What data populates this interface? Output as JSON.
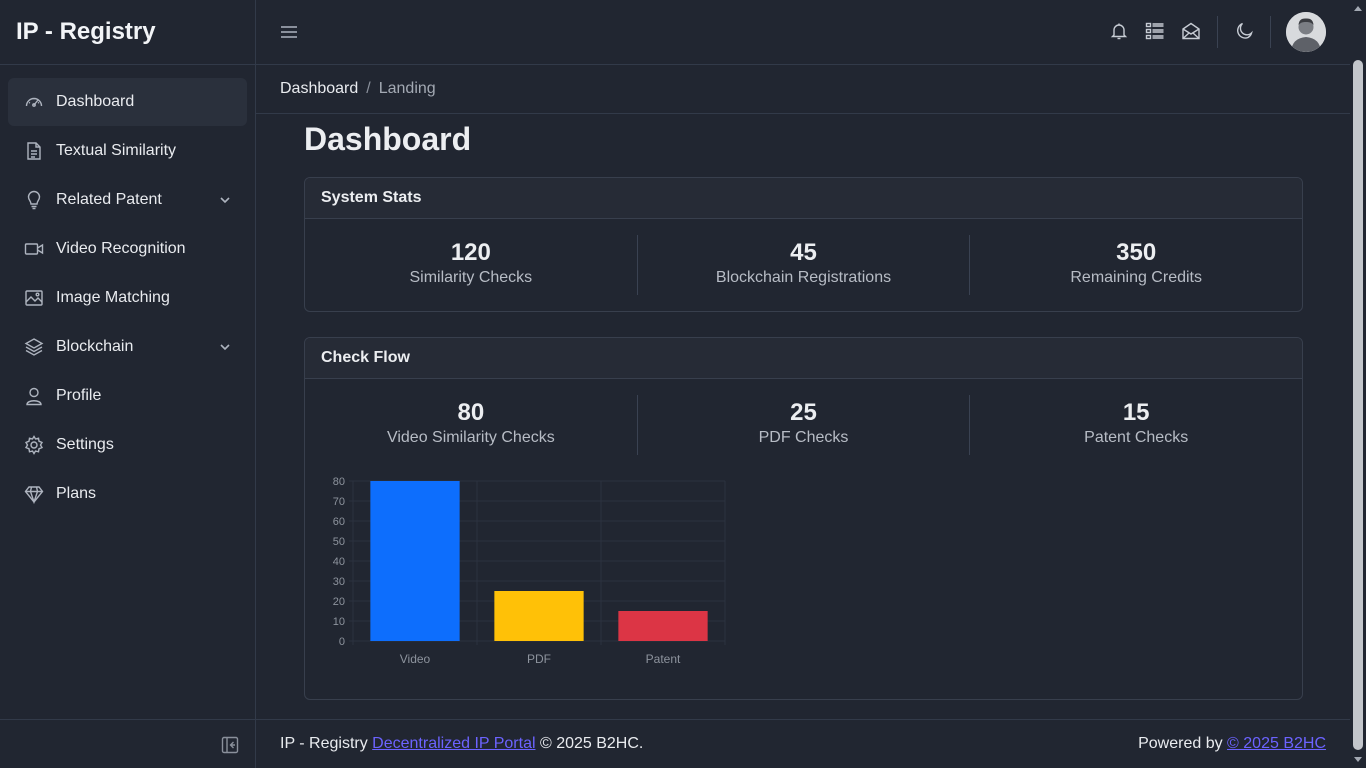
{
  "app": {
    "title": "IP - Registry"
  },
  "sidebar": {
    "items": [
      {
        "label": "Dashboard",
        "icon": "speedometer-icon",
        "active": true
      },
      {
        "label": "Textual Similarity",
        "icon": "document-icon"
      },
      {
        "label": "Related Patent",
        "icon": "lightbulb-icon",
        "has_children": true
      },
      {
        "label": "Video Recognition",
        "icon": "video-icon"
      },
      {
        "label": "Image Matching",
        "icon": "image-icon"
      },
      {
        "label": "Blockchain",
        "icon": "layers-icon",
        "has_children": true
      },
      {
        "label": "Profile",
        "icon": "user-icon"
      },
      {
        "label": "Settings",
        "icon": "gear-icon"
      },
      {
        "label": "Plans",
        "icon": "diamond-icon"
      }
    ]
  },
  "header": {
    "icons": [
      "bell-icon",
      "list-icon",
      "envelope-icon",
      "moon-icon"
    ]
  },
  "breadcrumb": {
    "home": "Dashboard",
    "separator": "/",
    "current": "Landing"
  },
  "main": {
    "title": "Dashboard",
    "system_stats": {
      "header": "System Stats",
      "stats": [
        {
          "value": "120",
          "label": "Similarity Checks"
        },
        {
          "value": "45",
          "label": "Blockchain Registrations"
        },
        {
          "value": "350",
          "label": "Remaining Credits"
        }
      ]
    },
    "check_flow": {
      "header": "Check Flow",
      "stats": [
        {
          "value": "80",
          "label": "Video Similarity Checks"
        },
        {
          "value": "25",
          "label": "PDF Checks"
        },
        {
          "value": "15",
          "label": "Patent Checks"
        }
      ]
    }
  },
  "chart_data": {
    "type": "bar",
    "categories": [
      "Video",
      "PDF",
      "Patent"
    ],
    "values": [
      80,
      25,
      15
    ],
    "colors": [
      "#0d6efd",
      "#ffc107",
      "#dc3545"
    ],
    "title": "",
    "xlabel": "",
    "ylabel": "",
    "ylim": [
      0,
      80
    ],
    "yticks": [
      0,
      10,
      20,
      30,
      40,
      50,
      60,
      70,
      80
    ],
    "grid": true
  },
  "footer": {
    "left_prefix": "IP - Registry ",
    "left_link": "Decentralized IP Portal",
    "left_suffix": " © 2025 B2HC.",
    "right_prefix": "Powered by ",
    "right_link": "© 2025 B2HC"
  }
}
